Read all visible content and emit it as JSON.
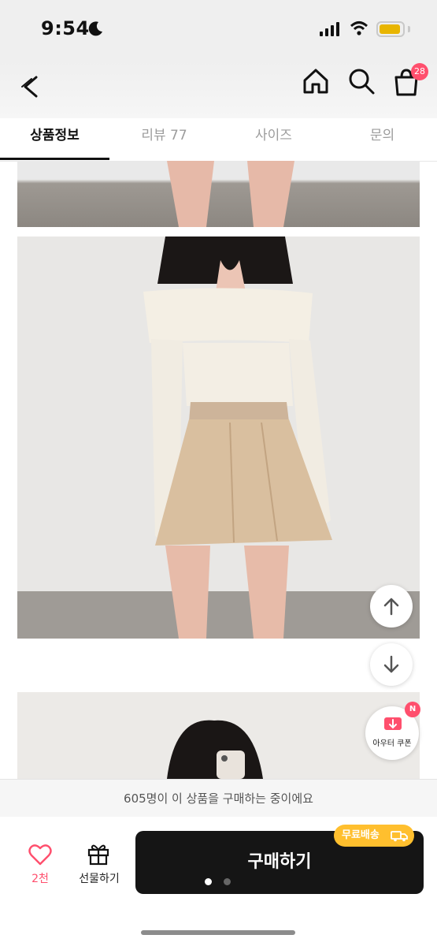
{
  "status_bar": {
    "time": "9:54"
  },
  "header": {
    "cart_count": "28"
  },
  "tabs": [
    {
      "label": "상품정보"
    },
    {
      "label": "리뷰 77"
    },
    {
      "label": "사이즈"
    },
    {
      "label": "문의"
    }
  ],
  "floating": {
    "coupon_label": "아우터 쿠폰",
    "coupon_badge": "N"
  },
  "banner": {
    "text": "605명이 이 상품을 구매하는 중이에요"
  },
  "bottom": {
    "like_count": "2천",
    "gift_label": "선물하기",
    "buy_label": "구매하기",
    "free_shipping_label": "무료배송"
  },
  "colors": {
    "accent": "#ff4f6d",
    "buy_button": "#151515",
    "free_shipping": "#ffbf2e"
  }
}
